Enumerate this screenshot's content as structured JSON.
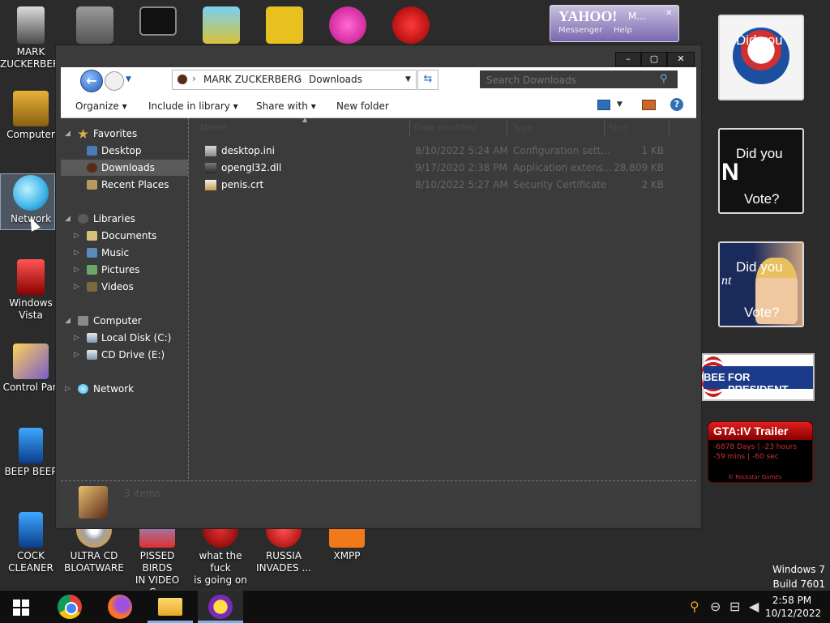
{
  "desktop": {
    "icons": [
      {
        "label": "MARK\nZUCKERBERG"
      },
      {
        "label": "Computer"
      },
      {
        "label": "Network"
      },
      {
        "label": "Windows\nVista"
      },
      {
        "label": "Control Pan"
      },
      {
        "label": "BEEP BEEP"
      },
      {
        "label": "COCK\nCLEANER"
      },
      {
        "label": "ULTRA CD\nBLOATWARE"
      },
      {
        "label": "PISSED BIRDS\nIN VIDEO G..."
      },
      {
        "label": "what the fuck\nis going on ..."
      },
      {
        "label": "RUSSIA\nINVADES ..."
      },
      {
        "label": "XMPP"
      }
    ],
    "watermark": {
      "line1": "Windows 7",
      "line2": "Build 7601"
    }
  },
  "gadgets": {
    "yahoo": {
      "brand": "YAHOO!",
      "sub": "Messenger",
      "help": "Help",
      "dots": "M..."
    },
    "vote1": {
      "text": "Did you"
    },
    "vote2": {
      "line1": "Did you",
      "letter": "N",
      "line2": "Vote?"
    },
    "vote3": {
      "line1": "Did you",
      "letter": "nt",
      "line2": "Vote?"
    },
    "banner": {
      "left": "BEE",
      "right": "FOR PRESIDENT"
    },
    "gta": {
      "title": "GTA:IV Trailer",
      "line1": "-6878 Days | -23 hours",
      "line2": "-59 mins | -60 sec",
      "footer": "© Rockstar Games"
    }
  },
  "window": {
    "caption": {
      "minimize": "–",
      "maximize": "▢",
      "close": "✕"
    },
    "breadcrumb": {
      "part1": "MARK ZUCKERBERG",
      "sep": "›",
      "part2": "Downloads"
    },
    "search_placeholder": "Search Downloads",
    "toolbar": {
      "organize": "Organize ▾",
      "include": "Include in library ▾",
      "share": "Share with ▾",
      "new_folder": "New folder"
    },
    "sidebar": {
      "favorites": "Favorites",
      "desktop": "Desktop",
      "downloads": "Downloads",
      "recent": "Recent Places",
      "libraries": "Libraries",
      "documents": "Documents",
      "music": "Music",
      "pictures": "Pictures",
      "videos": "Videos",
      "computer": "Computer",
      "local_disk": "Local Disk (C:)",
      "cd_drive": "CD Drive (E:)",
      "network": "Network"
    },
    "columns": {
      "name": "Name",
      "date": "Date modified",
      "type": "Type",
      "size": "Size"
    },
    "files": [
      {
        "name": "desktop.ini",
        "date": "8/10/2022 5:24 AM",
        "type": "Configuration sett...",
        "size": "1 KB"
      },
      {
        "name": "opengl32.dll",
        "date": "9/17/2020 2:38 PM",
        "type": "Application extens...",
        "size": "28,809 KB"
      },
      {
        "name": "penis.crt",
        "date": "8/10/2022 5:27 AM",
        "type": "Security Certificate",
        "size": "2 KB"
      }
    ],
    "status": "3 items"
  },
  "taskbar": {
    "time": "2:58 PM",
    "date": "10/12/2022"
  },
  "colors": {
    "accent": "#2e6fb7",
    "window_bg": "#3b3b3b",
    "desktop_bg": "#2b2b2b"
  }
}
